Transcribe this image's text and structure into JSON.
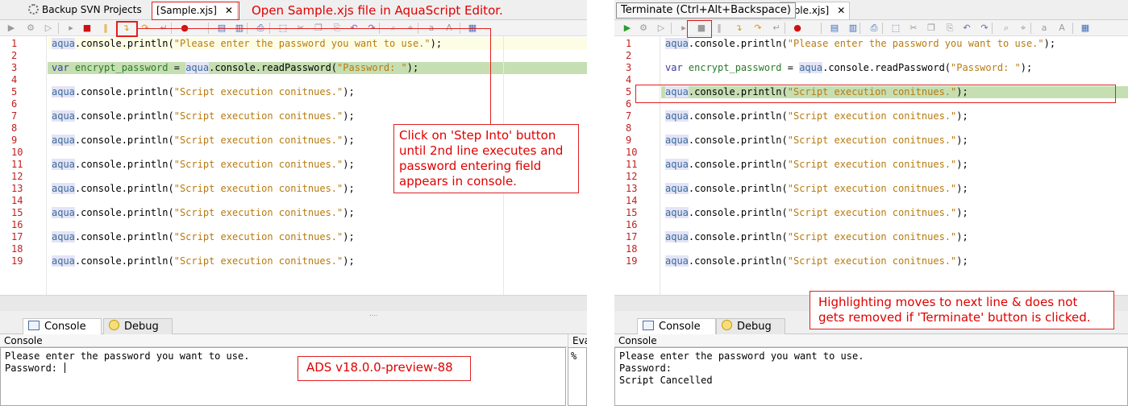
{
  "left": {
    "tabs": {
      "project_tab": "Backup SVN Projects",
      "file_tab": "Sample.xjs",
      "close_glyph": "✕"
    },
    "code_lines": [
      {
        "n": "1",
        "tokens": [
          [
            "aqua",
            "aqua"
          ],
          [
            ".console.println(",
            "plain"
          ],
          [
            "\"Please enter the password you want to use.\"",
            "str"
          ],
          [
            ");",
            "plain"
          ]
        ]
      },
      {
        "n": "2",
        "tokens": []
      },
      {
        "n": "3",
        "tokens": [
          [
            "var ",
            "kw"
          ],
          [
            "encrypt_password",
            "var"
          ],
          [
            " = ",
            "plain"
          ],
          [
            "aqua",
            "aqua"
          ],
          [
            ".console.readPassword(",
            "plain"
          ],
          [
            "\"Password: \"",
            "str"
          ],
          [
            ");",
            "plain"
          ]
        ]
      },
      {
        "n": "4",
        "tokens": []
      },
      {
        "n": "5",
        "tokens": [
          [
            "aqua",
            "aqua"
          ],
          [
            ".console.println(",
            "plain"
          ],
          [
            "\"Script execution conitnues.\"",
            "str"
          ],
          [
            ");",
            "plain"
          ]
        ]
      },
      {
        "n": "6",
        "tokens": []
      },
      {
        "n": "7",
        "tokens": [
          [
            "aqua",
            "aqua"
          ],
          [
            ".console.println(",
            "plain"
          ],
          [
            "\"Script execution conitnues.\"",
            "str"
          ],
          [
            ");",
            "plain"
          ]
        ]
      },
      {
        "n": "8",
        "tokens": []
      },
      {
        "n": "9",
        "tokens": [
          [
            "aqua",
            "aqua"
          ],
          [
            ".console.println(",
            "plain"
          ],
          [
            "\"Script execution conitnues.\"",
            "str"
          ],
          [
            ");",
            "plain"
          ]
        ]
      },
      {
        "n": "10",
        "tokens": []
      },
      {
        "n": "11",
        "tokens": [
          [
            "aqua",
            "aqua"
          ],
          [
            ".console.println(",
            "plain"
          ],
          [
            "\"Script execution conitnues.\"",
            "str"
          ],
          [
            ");",
            "plain"
          ]
        ]
      },
      {
        "n": "12",
        "tokens": []
      },
      {
        "n": "13",
        "tokens": [
          [
            "aqua",
            "aqua"
          ],
          [
            ".console.println(",
            "plain"
          ],
          [
            "\"Script execution conitnues.\"",
            "str"
          ],
          [
            ");",
            "plain"
          ]
        ]
      },
      {
        "n": "14",
        "tokens": []
      },
      {
        "n": "15",
        "tokens": [
          [
            "aqua",
            "aqua"
          ],
          [
            ".console.println(",
            "plain"
          ],
          [
            "\"Script execution conitnues.\"",
            "str"
          ],
          [
            ");",
            "plain"
          ]
        ]
      },
      {
        "n": "16",
        "tokens": []
      },
      {
        "n": "17",
        "tokens": [
          [
            "aqua",
            "aqua"
          ],
          [
            ".console.println(",
            "plain"
          ],
          [
            "\"Script execution conitnues.\"",
            "str"
          ],
          [
            ");",
            "plain"
          ]
        ]
      },
      {
        "n": "18",
        "tokens": []
      },
      {
        "n": "19",
        "tokens": [
          [
            "aqua",
            "aqua"
          ],
          [
            ".console.println(",
            "plain"
          ],
          [
            "\"Script execution conitnues.\"",
            "str"
          ],
          [
            ");",
            "plain"
          ]
        ]
      }
    ],
    "bottom_tabs": {
      "console": "Console",
      "debug": "Debug"
    },
    "console": {
      "label": "Console",
      "lines": [
        "Please enter the password you want to use.",
        "Password: "
      ]
    },
    "eval": {
      "label": "Eva",
      "content": "%"
    },
    "annotations": {
      "open_file": "Open Sample.xjs file in AquaScript Editor.",
      "step_into": "Click on 'Step Into' button until 2nd line executes and password entering field appears in console.",
      "version": "ADS v18.0.0-preview-88"
    }
  },
  "right": {
    "tabs": {
      "file_tab_partial": "mple.xjs]",
      "close_glyph": "✕"
    },
    "tooltip": "Terminate (Ctrl+Alt+Backspace)",
    "code_lines": [
      {
        "n": "1",
        "tokens": [
          [
            "aqua",
            "aqua"
          ],
          [
            ".console.println(",
            "plain"
          ],
          [
            "\"Please enter the password you want to use.\"",
            "str"
          ],
          [
            ");",
            "plain"
          ]
        ]
      },
      {
        "n": "2",
        "tokens": []
      },
      {
        "n": "3",
        "tokens": [
          [
            "var ",
            "kw"
          ],
          [
            "encrypt_password",
            "var"
          ],
          [
            " = ",
            "plain"
          ],
          [
            "aqua",
            "aqua"
          ],
          [
            ".console.readPassword(",
            "plain"
          ],
          [
            "\"Password: \"",
            "str"
          ],
          [
            ");",
            "plain"
          ]
        ]
      },
      {
        "n": "4",
        "tokens": []
      },
      {
        "n": "5",
        "tokens": [
          [
            "aqua",
            "aqua"
          ],
          [
            ".console.println(",
            "plain"
          ],
          [
            "\"Script execution conitnues.\"",
            "str"
          ],
          [
            ");",
            "plain"
          ]
        ]
      },
      {
        "n": "6",
        "tokens": []
      },
      {
        "n": "7",
        "tokens": [
          [
            "aqua",
            "aqua"
          ],
          [
            ".console.println(",
            "plain"
          ],
          [
            "\"Script execution conitnues.\"",
            "str"
          ],
          [
            ");",
            "plain"
          ]
        ]
      },
      {
        "n": "8",
        "tokens": []
      },
      {
        "n": "9",
        "tokens": [
          [
            "aqua",
            "aqua"
          ],
          [
            ".console.println(",
            "plain"
          ],
          [
            "\"Script execution conitnues.\"",
            "str"
          ],
          [
            ");",
            "plain"
          ]
        ]
      },
      {
        "n": "10",
        "tokens": []
      },
      {
        "n": "11",
        "tokens": [
          [
            "aqua",
            "aqua"
          ],
          [
            ".console.println(",
            "plain"
          ],
          [
            "\"Script execution conitnues.\"",
            "str"
          ],
          [
            ");",
            "plain"
          ]
        ]
      },
      {
        "n": "12",
        "tokens": []
      },
      {
        "n": "13",
        "tokens": [
          [
            "aqua",
            "aqua"
          ],
          [
            ".console.println(",
            "plain"
          ],
          [
            "\"Script execution conitnues.\"",
            "str"
          ],
          [
            ");",
            "plain"
          ]
        ]
      },
      {
        "n": "14",
        "tokens": []
      },
      {
        "n": "15",
        "tokens": [
          [
            "aqua",
            "aqua"
          ],
          [
            ".console.println(",
            "plain"
          ],
          [
            "\"Script execution conitnues.\"",
            "str"
          ],
          [
            ");",
            "plain"
          ]
        ]
      },
      {
        "n": "16",
        "tokens": []
      },
      {
        "n": "17",
        "tokens": [
          [
            "aqua",
            "aqua"
          ],
          [
            ".console.println(",
            "plain"
          ],
          [
            "\"Script execution conitnues.\"",
            "str"
          ],
          [
            ");",
            "plain"
          ]
        ]
      },
      {
        "n": "18",
        "tokens": []
      },
      {
        "n": "19",
        "tokens": [
          [
            "aqua",
            "aqua"
          ],
          [
            ".console.println(",
            "plain"
          ],
          [
            "\"Script execution conitnues.\"",
            "str"
          ],
          [
            ");",
            "plain"
          ]
        ]
      }
    ],
    "bottom_tabs": {
      "console": "Console",
      "debug": "Debug"
    },
    "console": {
      "label": "Console",
      "lines": [
        "Please enter the password you want to use.",
        "Password:",
        "Script Cancelled"
      ]
    },
    "annotations": {
      "highlight_note": "Highlighting moves to next line & does not gets removed if 'Terminate' button is clicked."
    }
  },
  "toolbar_icons": [
    "run-icon",
    "debug-run-icon",
    "resume-icon",
    "step-icon",
    "stop-icon",
    "pause-icon",
    "step-into-icon",
    "step-over-icon",
    "step-return-icon",
    "breakpoint-icon",
    "save-icon",
    "save-all-icon",
    "print-icon",
    "select-icon",
    "cut-icon",
    "copy-icon",
    "paste-icon",
    "undo-icon",
    "redo-icon",
    "find-icon",
    "find-replace-icon",
    "font-smaller-icon",
    "font-larger-icon",
    "outline-icon"
  ],
  "colors": {
    "highlight": "#c6dfb2",
    "annotation": "#e00000",
    "line_number": "#c02020",
    "string": "#b87a10"
  }
}
